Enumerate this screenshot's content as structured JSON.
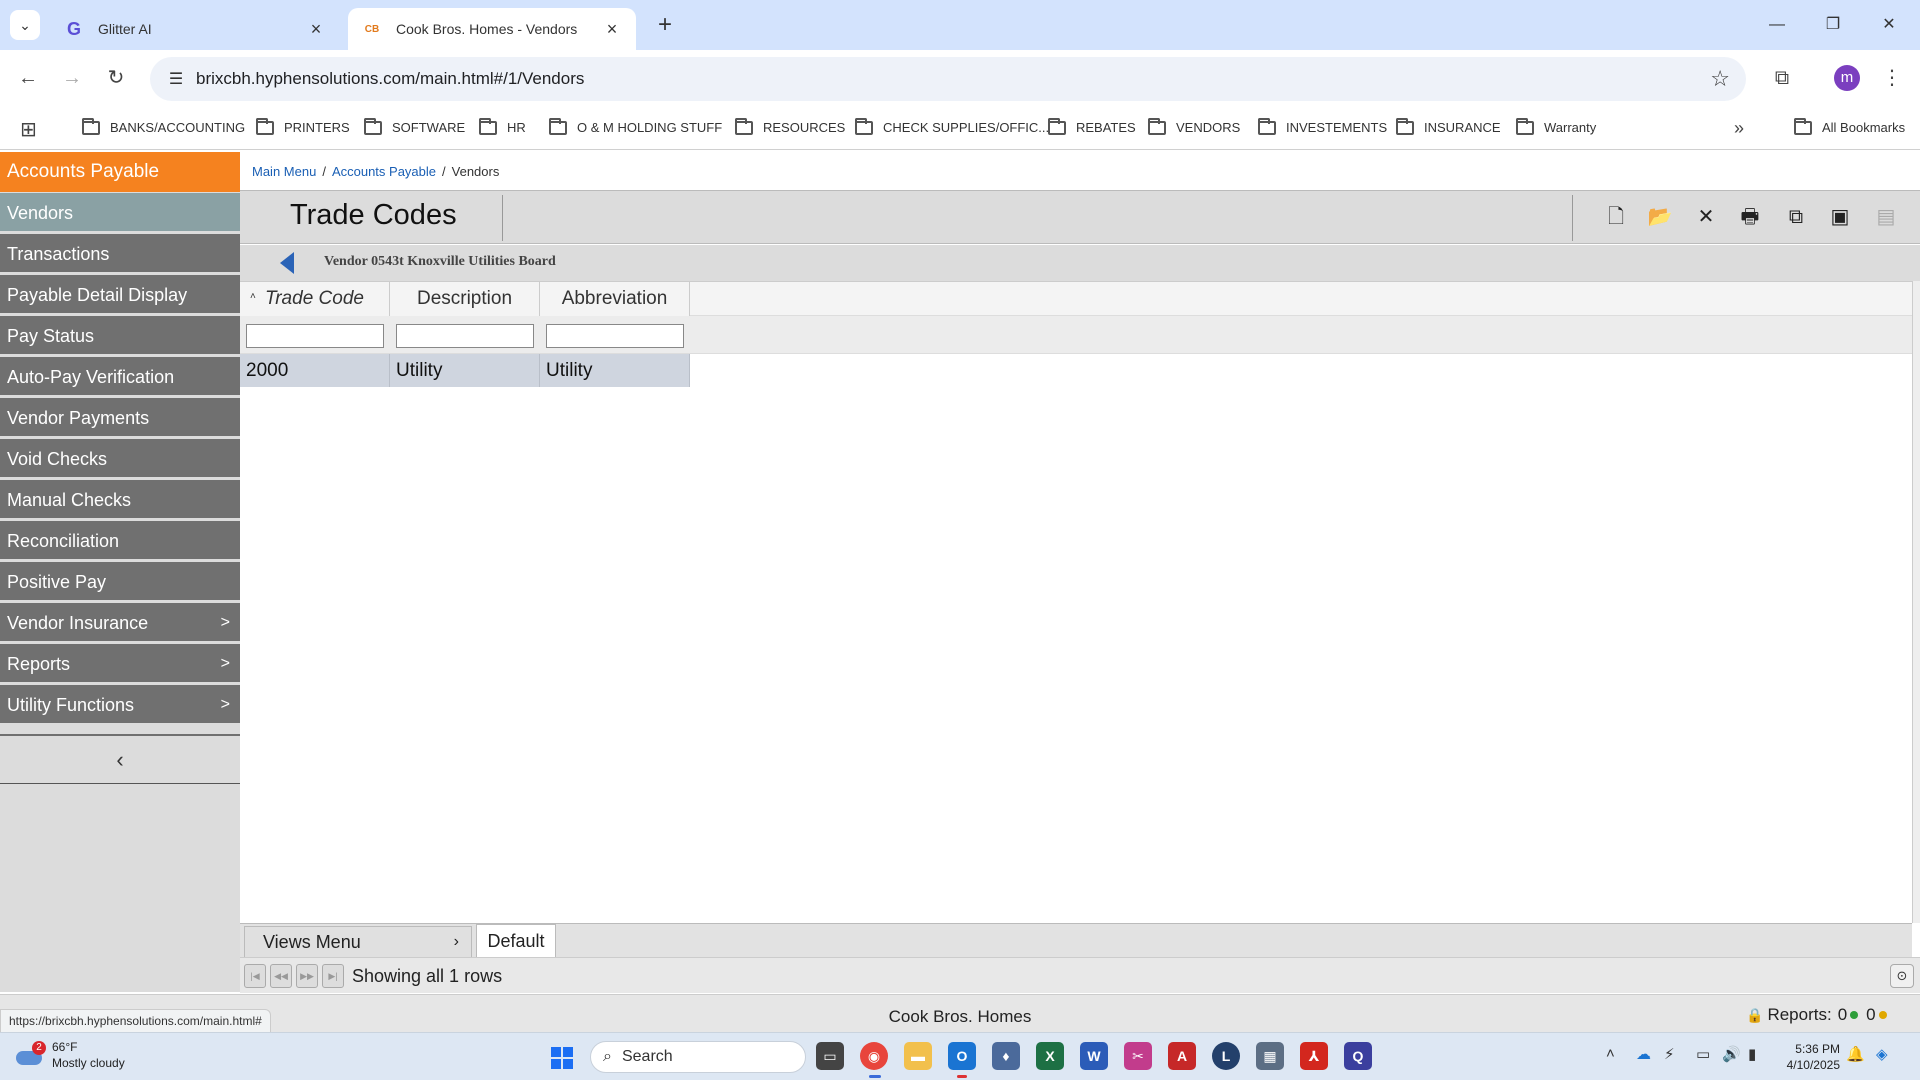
{
  "browser": {
    "tabs": [
      {
        "title": "Glitter AI",
        "active": false,
        "favicon": "G"
      },
      {
        "title": "Cook Bros. Homes - Vendors",
        "active": true,
        "favicon": "CB"
      }
    ],
    "url": "brixcbh.hyphensolutions.com/main.html#/1/Vendors",
    "profile_initial": "m",
    "bookmarks": [
      "BANKS/ACCOUNTING",
      "PRINTERS",
      "SOFTWARE",
      "HR",
      "O & M HOLDING STUFF",
      "RESOURCES",
      "CHECK SUPPLIES/OFFIC...",
      "REBATES",
      "VENDORS",
      "INVESTEMENTS",
      "INSURANCE",
      "Warranty"
    ],
    "all_bookmarks": "All Bookmarks"
  },
  "sidebar": {
    "header": "Accounts Payable",
    "items": [
      {
        "label": "Vendors",
        "selected": true,
        "submenu": false
      },
      {
        "label": "Transactions",
        "selected": false,
        "submenu": false
      },
      {
        "label": "Payable Detail Display",
        "selected": false,
        "submenu": false
      },
      {
        "label": "Pay Status",
        "selected": false,
        "submenu": false
      },
      {
        "label": "Auto-Pay Verification",
        "selected": false,
        "submenu": false
      },
      {
        "label": "Vendor Payments",
        "selected": false,
        "submenu": false
      },
      {
        "label": "Void Checks",
        "selected": false,
        "submenu": false
      },
      {
        "label": "Manual Checks",
        "selected": false,
        "submenu": false
      },
      {
        "label": "Reconciliation",
        "selected": false,
        "submenu": false
      },
      {
        "label": "Positive Pay",
        "selected": false,
        "submenu": false
      },
      {
        "label": "Vendor Insurance",
        "selected": false,
        "submenu": true
      },
      {
        "label": "Reports",
        "selected": false,
        "submenu": true
      },
      {
        "label": "Utility Functions",
        "selected": false,
        "submenu": true
      }
    ],
    "submenu_arrow": ">",
    "collapse_glyph": "‹"
  },
  "breadcrumb": {
    "main_menu": "Main Menu",
    "accounts_payable": "Accounts Payable",
    "current": "Vendors",
    "separator": "/"
  },
  "page": {
    "title": "Trade Codes",
    "vendor_label": "Vendor 0543t Knoxville Utilities Board"
  },
  "grid": {
    "columns": [
      "Trade Code",
      "Description",
      "Abbreviation"
    ],
    "sorted_column": "Trade Code",
    "rows": [
      [
        "2000",
        "Utility",
        "Utility"
      ]
    ]
  },
  "views": {
    "menu_label": "Views Menu",
    "tab_label": "Default"
  },
  "pager": {
    "text": "Showing all 1 rows"
  },
  "status": {
    "hover_url": "https://brixcbh.hyphensolutions.com/main.html#",
    "company": "Cook Bros. Homes",
    "reports_label": "Reports:",
    "reports_count_1": "0",
    "reports_count_2": "0"
  },
  "taskbar": {
    "weather_badge": "2",
    "temperature": "66°F",
    "weather": "Mostly cloudy",
    "search_placeholder": "Search",
    "time": "5:36 PM",
    "date": "4/10/2025"
  },
  "colors": {
    "sidebar_header": "#f5821f",
    "sidebar_selected": "#8aa1a4",
    "sidebar_item": "#707070",
    "link": "#1a5fb4",
    "row_bg": "#cfd5df",
    "report_dot_green": "#2e9e3a",
    "report_dot_yellow": "#e0a800"
  }
}
